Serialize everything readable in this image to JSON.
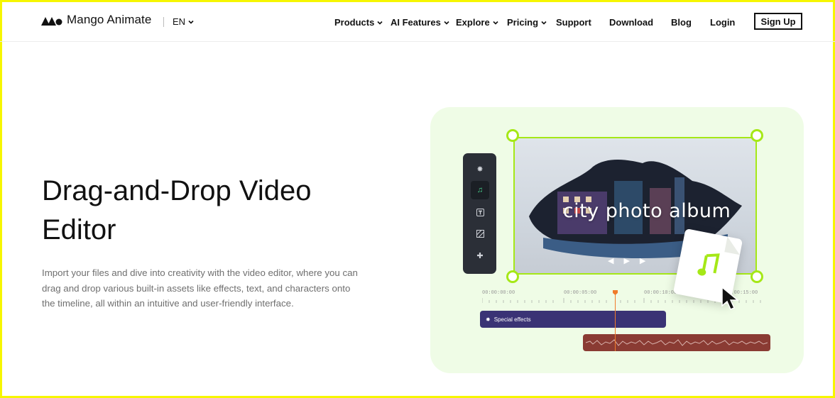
{
  "header": {
    "brand": "Mango Animate",
    "language": "EN",
    "nav": [
      {
        "label": "Products",
        "has_menu": true
      },
      {
        "label": "AI Features",
        "has_menu": true
      },
      {
        "label": "Explore",
        "has_menu": true
      },
      {
        "label": "Pricing",
        "has_menu": true
      },
      {
        "label": "Support",
        "has_menu": false
      },
      {
        "label": "Download",
        "has_menu": false
      },
      {
        "label": "Blog",
        "has_menu": false
      },
      {
        "label": "Login",
        "has_menu": false
      }
    ],
    "signup_label": "Sign Up"
  },
  "hero": {
    "title": "Drag-and-Drop Video Editor",
    "description": "Import your files and dive into creativity with the video editor, where you can drag and drop various built-in assets like effects, text, and characters onto the timeline, all within an intuitive and user-friendly interface."
  },
  "illustration": {
    "video_title": "city photo album",
    "toolbar_icons": [
      "effects-icon",
      "music-icon",
      "text-icon",
      "background-icon",
      "puzzle-icon"
    ],
    "active_tool": "music-icon",
    "timestamps": [
      "00:00:00:00",
      "00:00:05:00",
      "00:00:10:00",
      "00:00:15:00"
    ],
    "track_label": "Special effects",
    "colors": {
      "panel_bg": "#effce6",
      "accent_green": "#a5e817",
      "effects_track": "#3a3375",
      "audio_track": "#8a3b33",
      "playhead": "#f07b2a"
    }
  }
}
